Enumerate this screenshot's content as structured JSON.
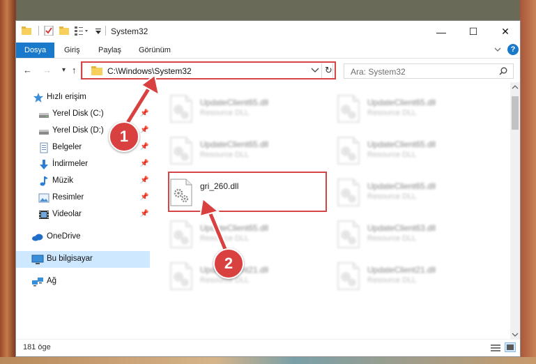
{
  "window": {
    "title": "System32",
    "controls": {
      "minimize": "—",
      "maximize": "☐",
      "close": "✕"
    }
  },
  "ribbon": {
    "tabs": [
      "Dosya",
      "Giriş",
      "Paylaş",
      "Görünüm"
    ],
    "help": "?"
  },
  "navigation": {
    "back": "←",
    "forward": "→",
    "recent": "▾",
    "up": "↑",
    "address": "C:\\Windows\\System32",
    "refresh": "↻",
    "search_placeholder": "Ara: System32"
  },
  "sidebar": {
    "items": [
      {
        "label": "Hızlı erişim",
        "icon": "star-icon",
        "pinned": false
      },
      {
        "label": "Yerel Disk (C:)",
        "icon": "drive-icon",
        "pinned": true
      },
      {
        "label": "Yerel Disk (D:)",
        "icon": "drive-icon",
        "pinned": true
      },
      {
        "label": "Belgeler",
        "icon": "documents-icon",
        "pinned": true
      },
      {
        "label": "İndirmeler",
        "icon": "download-icon",
        "pinned": true
      },
      {
        "label": "Müzik",
        "icon": "music-icon",
        "pinned": true
      },
      {
        "label": "Resimler",
        "icon": "pictures-icon",
        "pinned": true
      },
      {
        "label": "Videolar",
        "icon": "videos-icon",
        "pinned": true
      },
      {
        "label": "OneDrive",
        "icon": "cloud-icon",
        "pinned": false
      },
      {
        "label": "Bu bilgisayar",
        "icon": "computer-icon",
        "pinned": false
      },
      {
        "label": "Ağ",
        "icon": "network-icon",
        "pinned": false
      }
    ]
  },
  "files": [
    {
      "name": "UpdateClient65.dll",
      "type": "Resource DLL",
      "faded": true
    },
    {
      "name": "UpdateClient65.dll",
      "type": "Resource DLL",
      "faded": true
    },
    {
      "name": "UpdateClient65.dll",
      "type": "Resource DLL",
      "faded": true
    },
    {
      "name": "UpdateClient65.dll",
      "type": "Resource DLL",
      "faded": true
    },
    {
      "name": "gri_260.dll",
      "type": "",
      "faded": false
    },
    {
      "name": "UpdateClient65.dll",
      "type": "Resource DLL",
      "faded": true
    },
    {
      "name": "UpdateClient65.dll",
      "type": "Resource DLL",
      "faded": true
    },
    {
      "name": "UpdateClient63.dll",
      "type": "Resource DLL",
      "faded": true
    },
    {
      "name": "UpdateClient21.dll",
      "type": "Resource DLL",
      "faded": true
    },
    {
      "name": "UpdateClient21.dll",
      "type": "Resource DLL",
      "faded": true
    }
  ],
  "status": {
    "item_count": "181 öge"
  },
  "annotations": {
    "step1": "1",
    "step2": "2"
  },
  "colors": {
    "accent": "#1979ca",
    "highlight": "#d64545",
    "selection": "#cde8ff"
  }
}
